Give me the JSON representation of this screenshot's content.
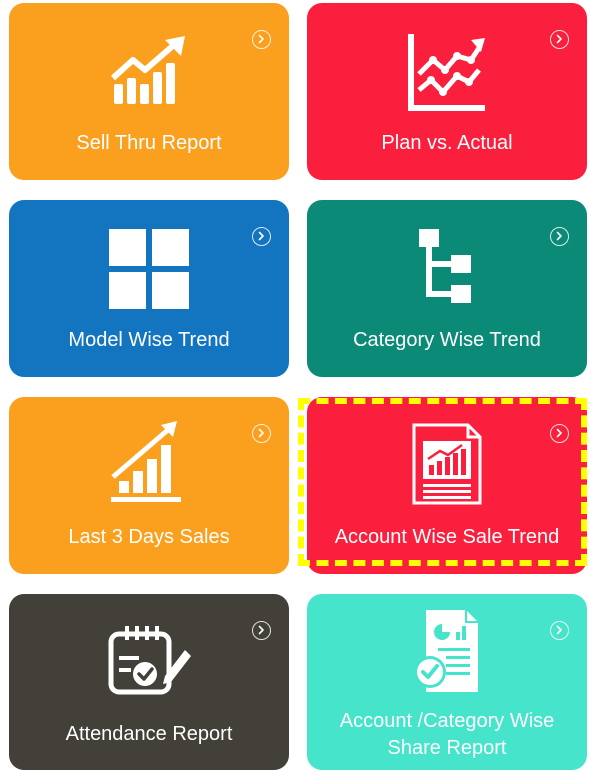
{
  "colors": {
    "orange": "#fba01e",
    "red": "#fb1f3e",
    "blue": "#1374c0",
    "teal": "#0b8a77",
    "dark": "#434039",
    "aqua": "#47e4cc",
    "highlight": "#ffff00"
  },
  "tiles": [
    {
      "label": "Sell Thru Report",
      "icon": "growth-bar-chart-icon",
      "color": "orange"
    },
    {
      "label": "Plan vs. Actual",
      "icon": "line-graph-icon",
      "color": "red"
    },
    {
      "label": "Model Wise Trend",
      "icon": "grid-tiles-icon",
      "color": "blue"
    },
    {
      "label": "Category Wise Trend",
      "icon": "hierarchy-tree-icon",
      "color": "teal"
    },
    {
      "label": "Last 3 Days Sales",
      "icon": "rising-bars-icon",
      "color": "orange"
    },
    {
      "label": "Account Wise Sale Trend",
      "icon": "report-document-icon",
      "color": "red",
      "highlighted": true
    },
    {
      "label": "Attendance Report",
      "icon": "attendance-checklist-icon",
      "color": "dark"
    },
    {
      "label_line1": "Account /Category Wise",
      "label_line2": "Share Report",
      "icon": "share-report-icon",
      "color": "aqua"
    }
  ],
  "chevron_icon": "chevron-right-circle-icon"
}
